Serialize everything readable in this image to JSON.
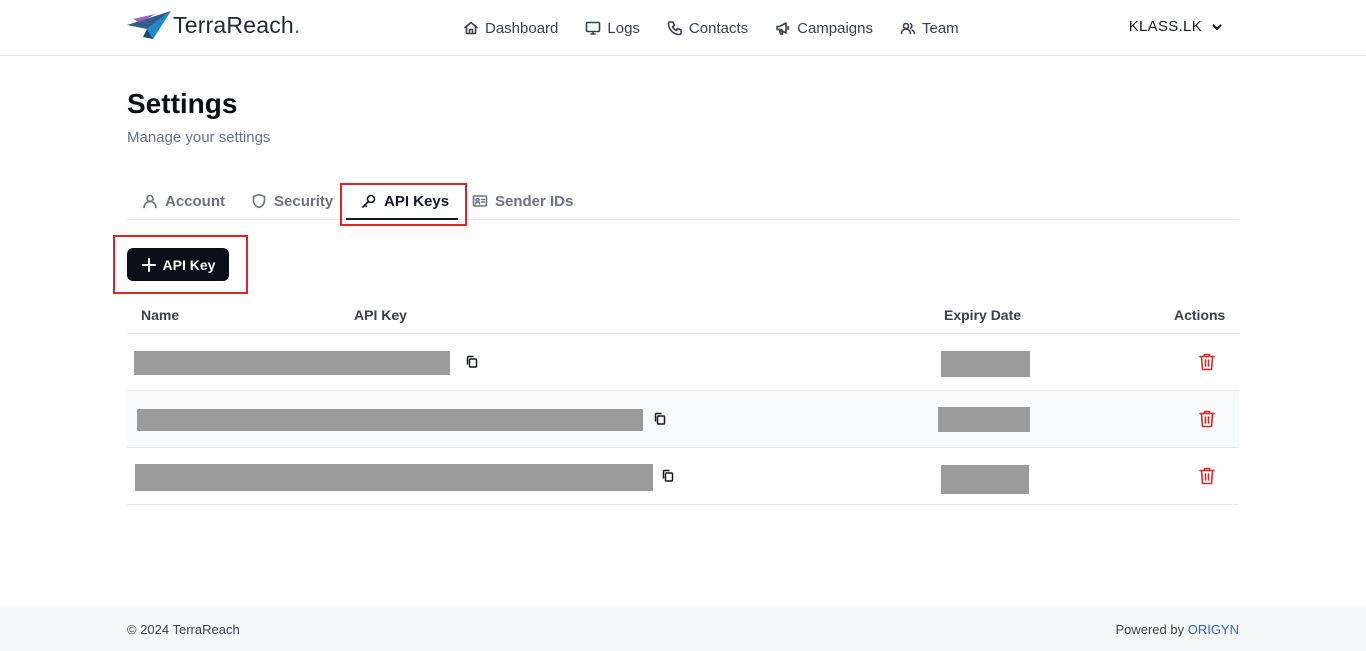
{
  "app": {
    "brand": "TerraReach",
    "brand_dot": ".",
    "org_name": "KLASS.LK"
  },
  "nav": {
    "items": [
      {
        "label": "Dashboard",
        "icon": "home-icon"
      },
      {
        "label": "Logs",
        "icon": "monitor-icon"
      },
      {
        "label": "Contacts",
        "icon": "phone-icon"
      },
      {
        "label": "Campaigns",
        "icon": "megaphone-icon"
      },
      {
        "label": "Team",
        "icon": "users-icon"
      }
    ]
  },
  "page": {
    "title": "Settings",
    "subtitle": "Manage your settings"
  },
  "tabs": [
    {
      "label": "Account",
      "icon": "user-icon",
      "active": false
    },
    {
      "label": "Security",
      "icon": "shield-icon",
      "active": false
    },
    {
      "label": "API Keys",
      "icon": "key-icon",
      "active": true
    },
    {
      "label": "Sender IDs",
      "icon": "id-card-icon",
      "active": false
    }
  ],
  "add_button": {
    "label": "API Key",
    "icon": "plus-icon"
  },
  "table": {
    "columns": [
      "Name",
      "API Key",
      "Expiry Date",
      "Actions"
    ],
    "rows": [
      {
        "name": "",
        "api_key": "",
        "expiry": "",
        "redacted": true
      },
      {
        "name": "",
        "api_key": "",
        "expiry": "",
        "redacted": true
      },
      {
        "name": "",
        "api_key": "",
        "expiry": "",
        "redacted": true
      }
    ]
  },
  "footer": {
    "copyright": "© 2024 TerraReach",
    "powered_prefix": "Powered by ",
    "powered_brand": "ORIGYN"
  },
  "colors": {
    "primary": "#0b0f19",
    "brand_blue": "#1d6fb8",
    "danger": "#dc2626",
    "highlight": "#dc2626",
    "redaction": "#9b9b9b"
  }
}
